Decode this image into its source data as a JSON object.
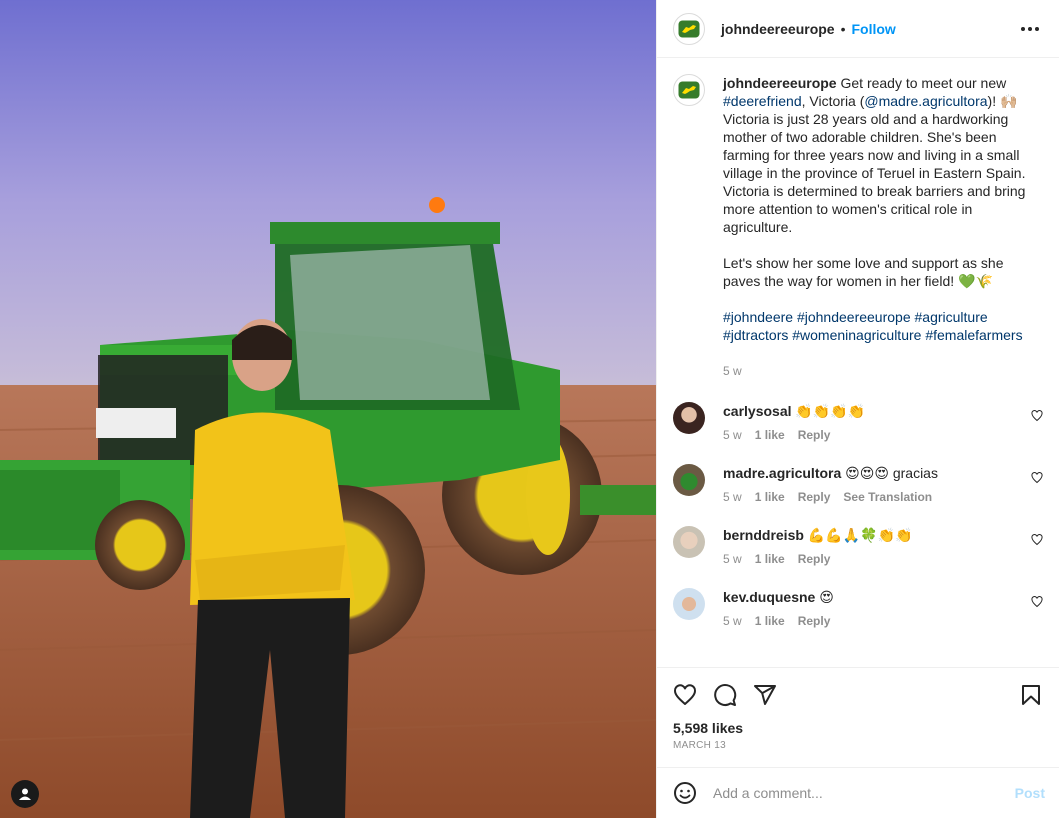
{
  "post": {
    "username": "johndeereeurope",
    "follow_label": "Follow",
    "separator": "•",
    "more_icon": "more-horizontal-icon",
    "photo_alt": "Woman in yellow hoodie in front of green John Deere tractor"
  },
  "caption": {
    "username": "johndeereeurope",
    "p1_a": " Get ready to meet our new ",
    "p1_hashtag": "#deerefriend",
    "p1_b": ", Victoria (",
    "p1_mention": "@madre.agricultora",
    "p1_c": ")! 🙌🏼 Victoria is just 28 years old and a hardworking mother of two adorable children. She's been farming for three years now and living in a small village in the province of Teruel in Eastern Spain. Victoria is determined to break barriers and bring more attention to women's critical role in agriculture.",
    "p2": "Let's show her some love and support as she paves the way for women in her field! 💚🌾",
    "hashtags": "#johndeere #johndeereeurope #agriculture #jdtractors #womeninagriculture #femalefarmers",
    "time": "5 w"
  },
  "comments": [
    {
      "user": "carlysosal",
      "text": "👏👏👏👏",
      "time": "5 w",
      "likes": "1 like",
      "reply": "Reply",
      "extra": ""
    },
    {
      "user": "madre.agricultora",
      "text": "😍😍😍 gracias",
      "time": "5 w",
      "likes": "1 like",
      "reply": "Reply",
      "extra": "See Translation"
    },
    {
      "user": "bernddreisb",
      "text": "💪💪🙏🍀👏👏",
      "time": "5 w",
      "likes": "1 like",
      "reply": "Reply",
      "extra": ""
    },
    {
      "user": "kev.duquesne",
      "text": "😍",
      "time": "5 w",
      "likes": "1 like",
      "reply": "Reply",
      "extra": ""
    }
  ],
  "actions": {
    "likes": "5,598 likes",
    "date": "MARCH 13",
    "icons": [
      "heart-icon",
      "comment-icon",
      "share-icon",
      "bookmark-icon"
    ]
  },
  "add_comment": {
    "placeholder": "Add a comment...",
    "post_label": "Post"
  },
  "colors": {
    "accent": "#0095f6",
    "deere_green": "#367c2b",
    "deere_yellow": "#ffde00",
    "link": "#00376b",
    "muted": "#8e8e8e"
  }
}
